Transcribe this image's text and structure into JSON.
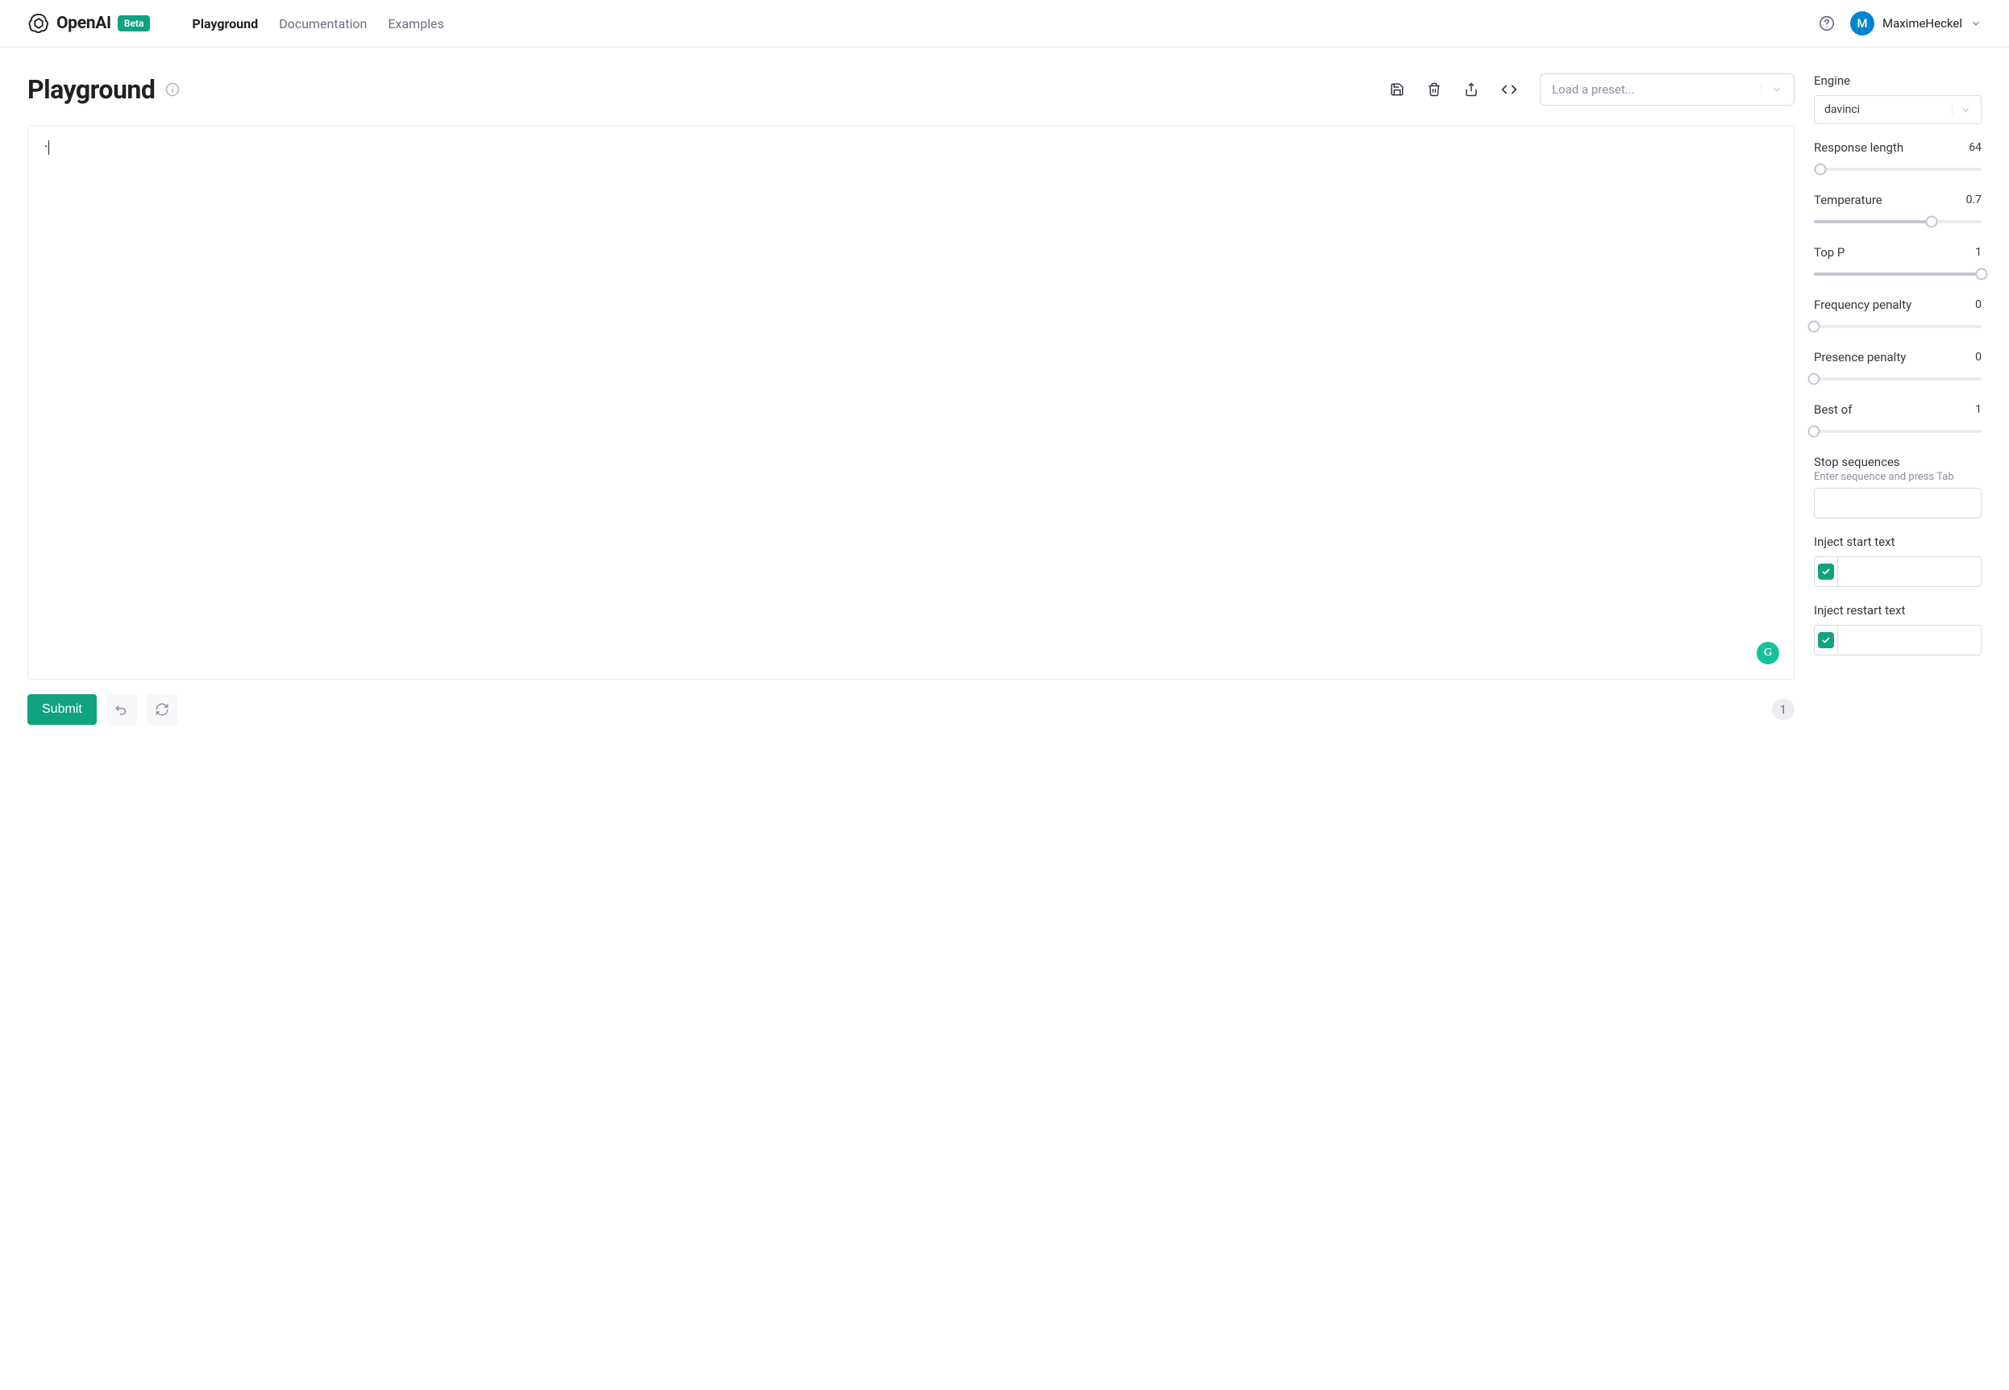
{
  "header": {
    "brand": "OpenAI",
    "beta_label": "Beta",
    "nav": {
      "playground": "Playground",
      "documentation": "Documentation",
      "examples": "Examples"
    },
    "user": {
      "avatar_initial": "M",
      "name": "MaximeHeckel"
    }
  },
  "page": {
    "title": "Playground",
    "preset_placeholder": "Load a preset...",
    "editor_value": "`",
    "grammarly_initial": "G",
    "submit_label": "Submit",
    "count": "1"
  },
  "params": {
    "engine": {
      "label": "Engine",
      "value": "davinci"
    },
    "response_length": {
      "label": "Response length",
      "value": "64",
      "pct": 4
    },
    "temperature": {
      "label": "Temperature",
      "value": "0.7",
      "pct": 70
    },
    "top_p": {
      "label": "Top P",
      "value": "1",
      "pct": 100
    },
    "frequency_penalty": {
      "label": "Frequency penalty",
      "value": "0",
      "pct": 0
    },
    "presence_penalty": {
      "label": "Presence penalty",
      "value": "0",
      "pct": 0
    },
    "best_of": {
      "label": "Best of",
      "value": "1",
      "pct": 0
    },
    "stop_sequences": {
      "label": "Stop sequences",
      "hint": "Enter sequence and press Tab"
    },
    "inject_start": {
      "label": "Inject start text",
      "checked": true
    },
    "inject_restart": {
      "label": "Inject restart text",
      "checked": true
    }
  }
}
